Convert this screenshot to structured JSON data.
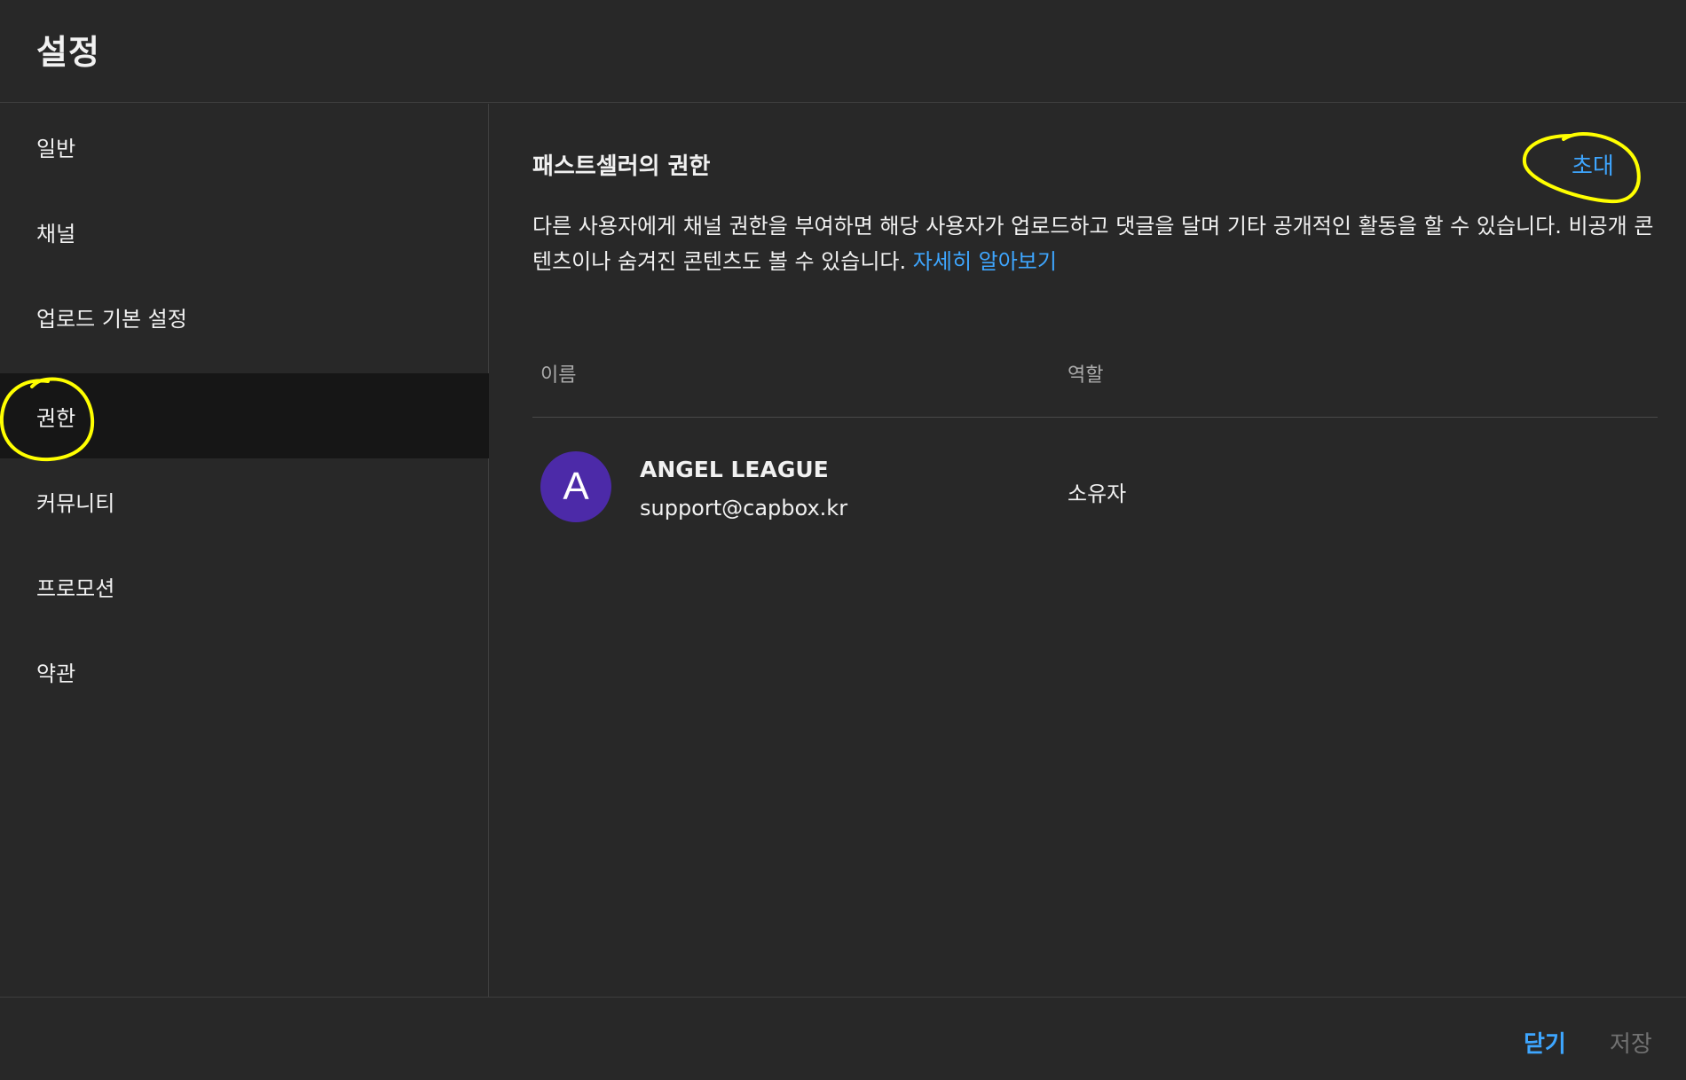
{
  "header": {
    "title": "설정"
  },
  "sidebar": {
    "items": [
      {
        "label": "일반"
      },
      {
        "label": "채널"
      },
      {
        "label": "업로드 기본 설정"
      },
      {
        "label": "권한",
        "active": true
      },
      {
        "label": "커뮤니티"
      },
      {
        "label": "프로모션"
      },
      {
        "label": "약관"
      }
    ]
  },
  "main": {
    "section_title": "패스트셀러의 권한",
    "invite_label": "초대",
    "description": "다른 사용자에게 채널 권한을 부여하면 해당 사용자가 업로드하고 댓글을 달며 기타 공개적인 활동을 할 수 있습니다. 비공개 콘텐츠이나 숨겨진 콘텐츠도 볼 수 있습니다.",
    "learn_more": "자세히 알아보기",
    "table": {
      "columns": [
        "이름",
        "역할"
      ],
      "rows": [
        {
          "avatar_letter": "A",
          "name": "ANGEL LEAGUE",
          "email": "support@capbox.kr",
          "role": "소유자"
        }
      ]
    }
  },
  "footer": {
    "close_label": "닫기",
    "save_label": "저장"
  },
  "colors": {
    "background": "#282828",
    "active_item": "#161616",
    "accent": "#3ea6ff",
    "avatar": "#4c2aa8",
    "annotation": "#ffff00"
  }
}
